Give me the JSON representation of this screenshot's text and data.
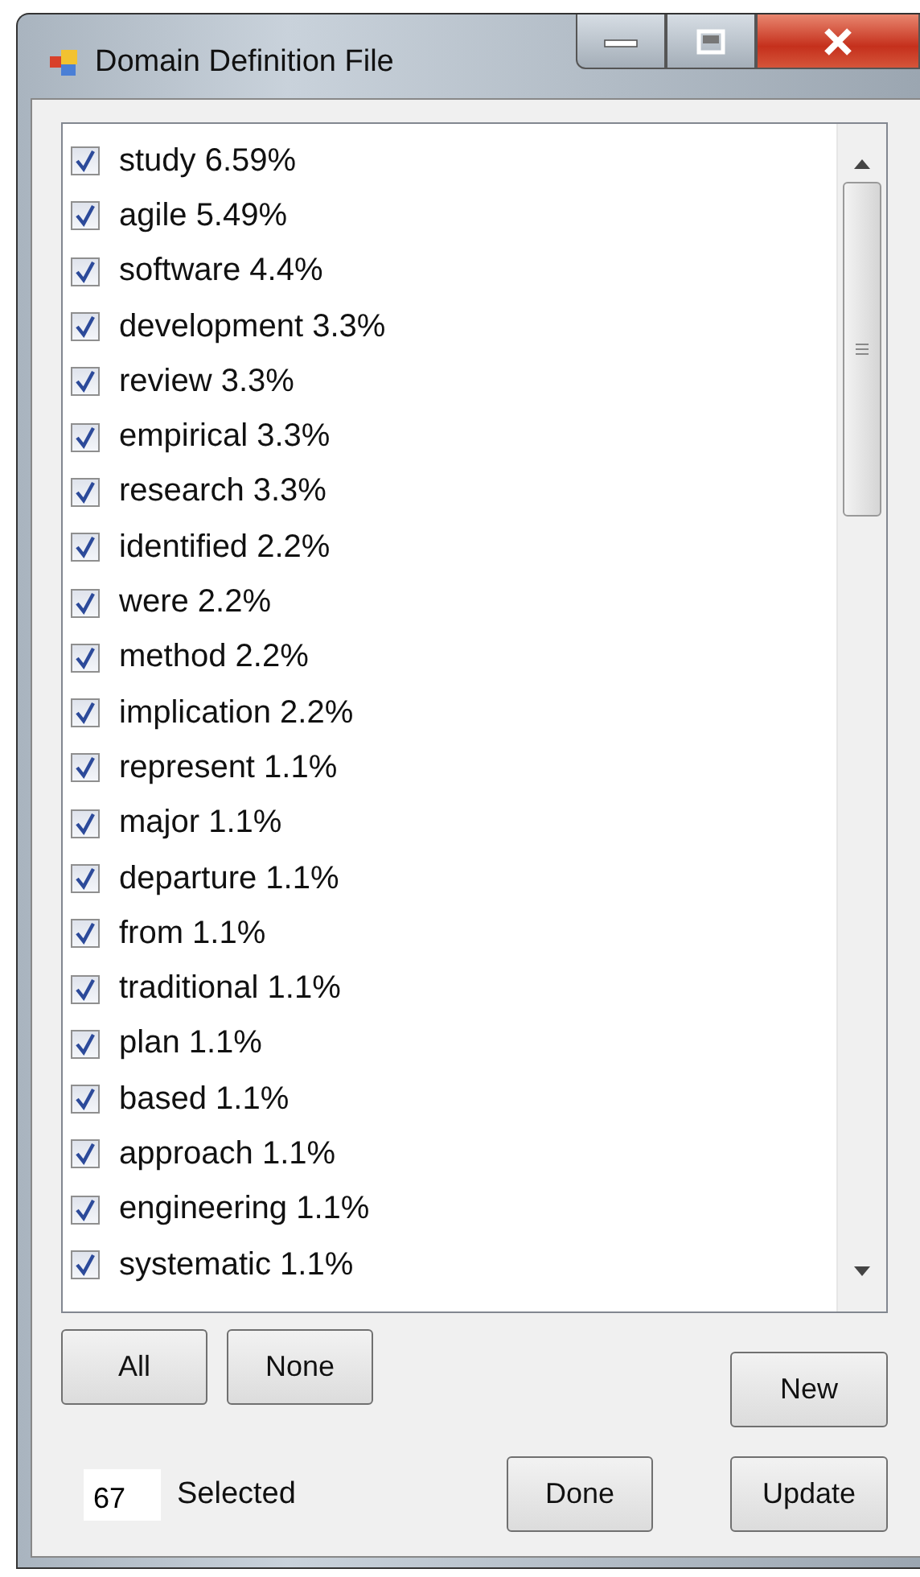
{
  "window": {
    "title": "Domain Definition File"
  },
  "items": [
    {
      "label": "study 6.59%",
      "checked": true
    },
    {
      "label": "agile 5.49%",
      "checked": true
    },
    {
      "label": "software 4.4%",
      "checked": true
    },
    {
      "label": "development 3.3%",
      "checked": true
    },
    {
      "label": "review 3.3%",
      "checked": true
    },
    {
      "label": "empirical 3.3%",
      "checked": true
    },
    {
      "label": "research 3.3%",
      "checked": true
    },
    {
      "label": "identified 2.2%",
      "checked": true
    },
    {
      "label": "were 2.2%",
      "checked": true
    },
    {
      "label": "method 2.2%",
      "checked": true
    },
    {
      "label": "implication 2.2%",
      "checked": true
    },
    {
      "label": "represent 1.1%",
      "checked": true
    },
    {
      "label": "major 1.1%",
      "checked": true
    },
    {
      "label": "departure 1.1%",
      "checked": true
    },
    {
      "label": "from 1.1%",
      "checked": true
    },
    {
      "label": "traditional 1.1%",
      "checked": true
    },
    {
      "label": "plan 1.1%",
      "checked": true
    },
    {
      "label": "based 1.1%",
      "checked": true
    },
    {
      "label": "approach 1.1%",
      "checked": true
    },
    {
      "label": "engineering 1.1%",
      "checked": true
    },
    {
      "label": "systematic 1.1%",
      "checked": true
    }
  ],
  "buttons": {
    "all": "All",
    "none": "None",
    "new": "New",
    "done": "Done",
    "update": "Update"
  },
  "selected_count": {
    "value": "67",
    "label": "Selected"
  }
}
